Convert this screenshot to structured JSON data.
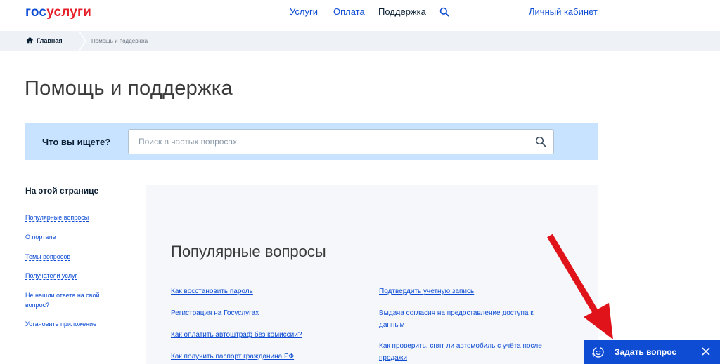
{
  "header": {
    "logo_part1": "гос",
    "logo_part2": "услуги",
    "nav": [
      "Услуги",
      "Оплата",
      "Поддержка"
    ],
    "cabinet": "Личный кабинет"
  },
  "breadcrumb": {
    "home": "Главная",
    "current": "Помощь и поддержка"
  },
  "page": {
    "title": "Помощь и поддержка"
  },
  "search": {
    "label": "Что вы ищете?",
    "placeholder": "Поиск в частых вопросах",
    "value": ""
  },
  "sidebar": {
    "title": "На этой странице",
    "items": [
      "Популярные вопросы",
      "О портале",
      "Темы вопросов",
      "Получатели услуг",
      "Не нашли ответа на свой вопрос?",
      "Установите приложение"
    ]
  },
  "popular": {
    "title": "Популярные вопросы",
    "left": [
      "Как восстановить пароль",
      "Регистрация на Госуслугах",
      "Как оплатить автоштраф без комиссии?",
      "Как получить паспорт гражданина РФ"
    ],
    "right": [
      "Подтвердить учетную запись",
      "Выдача согласия на предоставление доступа к данным",
      "Как проверить, снят ли автомобиль с учёта после продажи"
    ]
  },
  "chat": {
    "label": "Задать вопрос"
  },
  "colors": {
    "brand_blue": "#0d4cd3",
    "brand_red": "#e61e27",
    "search_band": "#c7e3ff",
    "arrow_red": "#e0121a"
  },
  "icons": {
    "search": "search-icon",
    "home": "home-icon",
    "chat": "support-operator-icon",
    "close": "close-icon"
  }
}
